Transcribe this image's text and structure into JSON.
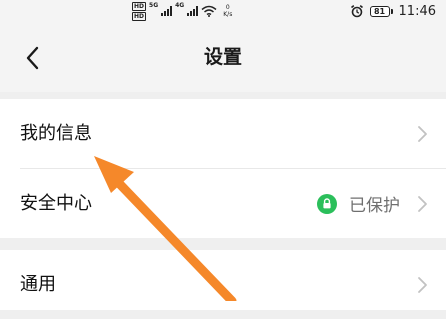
{
  "status_bar": {
    "hd_top": "HD",
    "hd_bottom": "HD",
    "gen1": "5G",
    "gen2": "4G",
    "speed_value": "0",
    "speed_unit": "K/s",
    "battery_level": "81",
    "time": "11:46",
    "icons": [
      "hd-icon",
      "signal-icon",
      "wifi-icon",
      "alarm-icon",
      "battery-icon"
    ]
  },
  "header": {
    "title": "设置",
    "back_icon": "chevron-left-icon"
  },
  "settings": {
    "my_info": "我的信息",
    "security_center": "安全中心",
    "security_status": "已保护",
    "general": "通用"
  },
  "colors": {
    "page_bg": "#efefef",
    "shield_green": "#2bbf5b",
    "annotation_arrow": "#f5882a"
  }
}
